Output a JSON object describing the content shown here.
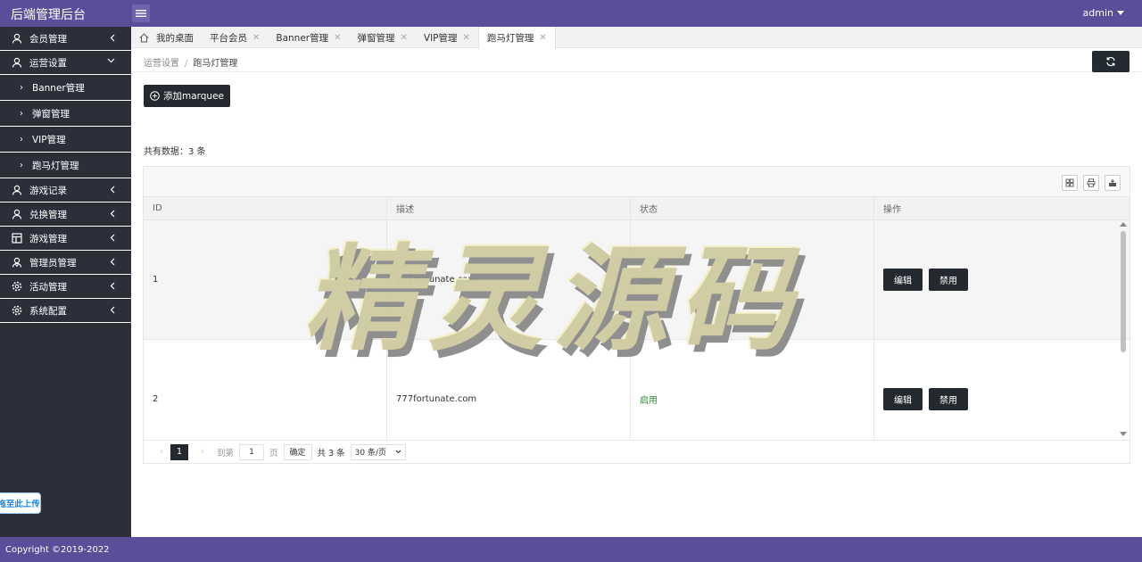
{
  "header": {
    "brand": "后端管理后台",
    "user": "admin"
  },
  "sidebar": {
    "items": [
      {
        "label": "会员管理",
        "icon": "user-icon"
      },
      {
        "label": "运营设置",
        "icon": "user-icon",
        "expanded": true,
        "children": [
          "Banner管理",
          "弹窗管理",
          "VIP管理",
          "跑马灯管理"
        ]
      },
      {
        "label": "游戏记录",
        "icon": "user-icon"
      },
      {
        "label": "兑换管理",
        "icon": "user-icon"
      },
      {
        "label": "游戏管理",
        "icon": "grid-icon"
      },
      {
        "label": "管理员管理",
        "icon": "admin-icon"
      },
      {
        "label": "活动管理",
        "icon": "gear-icon"
      },
      {
        "label": "系统配置",
        "icon": "gear-icon"
      }
    ],
    "upload_tip": "拖至此上传"
  },
  "tabs": [
    {
      "label": "我的桌面",
      "closable": false
    },
    {
      "label": "平台会员",
      "closable": true
    },
    {
      "label": "Banner管理",
      "closable": true
    },
    {
      "label": "弹窗管理",
      "closable": true
    },
    {
      "label": "VIP管理",
      "closable": true
    },
    {
      "label": "跑马灯管理",
      "closable": true,
      "active": true
    }
  ],
  "breadcrumb": {
    "parent": "运营设置",
    "sep": "/",
    "current": "跑马灯管理"
  },
  "content": {
    "add_button": "添加marquee",
    "total_text": "共有数据：3 条"
  },
  "table": {
    "columns": [
      "ID",
      "描述",
      "状态",
      "操作"
    ],
    "rows": [
      {
        "id": "1",
        "desc": "777fortunate.com",
        "status": "启用",
        "edit": "编辑",
        "disable": "禁用"
      },
      {
        "id": "2",
        "desc": "777fortunate.com",
        "status": "启用",
        "edit": "编辑",
        "disable": "禁用"
      }
    ]
  },
  "pager": {
    "current_page": "1",
    "goto_label": "到第",
    "goto_value": "1",
    "page_unit": "页",
    "confirm": "确定",
    "total": "共 3 条",
    "page_size": "30 条/页"
  },
  "watermark": "精灵源码",
  "footer": {
    "copyright": "Copyright ©2019-2022"
  },
  "colors": {
    "header": "#5a4e9b",
    "sidebar": "#2a2f3a",
    "button": "#23292e",
    "status_on": "#2e8b2e"
  }
}
